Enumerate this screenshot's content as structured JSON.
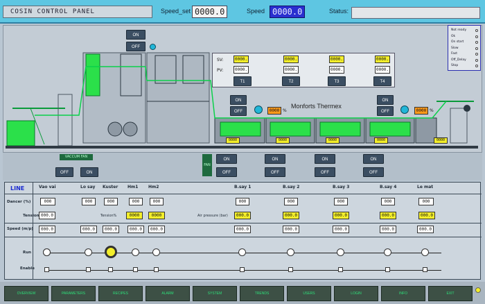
{
  "title": "COSIN CONTROL PANEL",
  "speed_set": {
    "label": "Speed_set",
    "value": "0000.0"
  },
  "speed": {
    "label": "Speed",
    "value": "0000.0"
  },
  "status": {
    "label": "Status:",
    "value": ""
  },
  "machine": {
    "on": "ON",
    "off": "OFF",
    "thermex_label": "Monforts Thermex",
    "sv_label": "SV:",
    "pv_label": "PV:",
    "sv_values": [
      "0000.",
      "0000.",
      "0000.",
      "0000."
    ],
    "pv_values": [
      "0000.",
      "0000.",
      "0000.",
      "0000."
    ],
    "temps": [
      "T1",
      "T2",
      "T3",
      "T4"
    ],
    "pct_left": "0000",
    "pct_left_unit": "%",
    "pct_right": "0000",
    "pct_right_unit": "%",
    "zone_values": [
      "0000",
      "0000",
      "0000",
      "0000",
      "0000"
    ],
    "zone_unit": "%"
  },
  "legend": [
    "Not ready",
    "Ok",
    "On start",
    "Slow",
    "Fast",
    "Off_Delay",
    "Stop"
  ],
  "mid": {
    "vaccum_fan": "VACCUM FAN",
    "off": "OFF",
    "on": "ON",
    "fan": "FAN",
    "fan_buttons": [
      {
        "on": "ON",
        "off": "OFF"
      },
      {
        "on": "ON",
        "off": "OFF"
      },
      {
        "on": "ON",
        "off": "OFF"
      },
      {
        "on": "ON",
        "off": "OFF"
      }
    ]
  },
  "table": {
    "line_label": "LINE",
    "columns": [
      "Vao vai",
      "Lo say",
      "Kuster",
      "Hm1",
      "Hm2",
      "B.say 1",
      "B.say 2",
      "B.say 3",
      "B.say 4",
      "Le mat"
    ],
    "row_labels": {
      "dancer": "Dancer (%)",
      "tension": "Tension",
      "speed": "Speed (m/p)",
      "run": "Run",
      "enable": "Enable"
    },
    "tension_pct": "Tension%",
    "air_pressure": "Air pressure (bar)",
    "dancer_values": [
      "000",
      "000",
      "000",
      "000",
      "000",
      "000",
      "000",
      "000",
      "000",
      "000"
    ],
    "tension_values": [
      "0000",
      "0000",
      "000.0",
      "000.0",
      "000.0",
      "000.0",
      "000.0"
    ],
    "speed_values": [
      "000.0",
      "000.0",
      "000.0",
      "000.0",
      "000.0",
      "000.0",
      "000.0",
      "000.0",
      "000.0",
      "000.0"
    ]
  },
  "bottom_buttons": [
    "OVERVIEW",
    "PARAMETERS",
    "RECIPES",
    "ALARM",
    "SYSTEM",
    "TRENDS",
    "USERS",
    "LOGIN",
    "INFO",
    "EXIT"
  ],
  "colors": {
    "accent": "#5ec6e2",
    "green": "#2ee07a",
    "yellow": "#f3ee2a",
    "orange": "#ff9a1a",
    "blue_display": "#2a2fd0"
  }
}
